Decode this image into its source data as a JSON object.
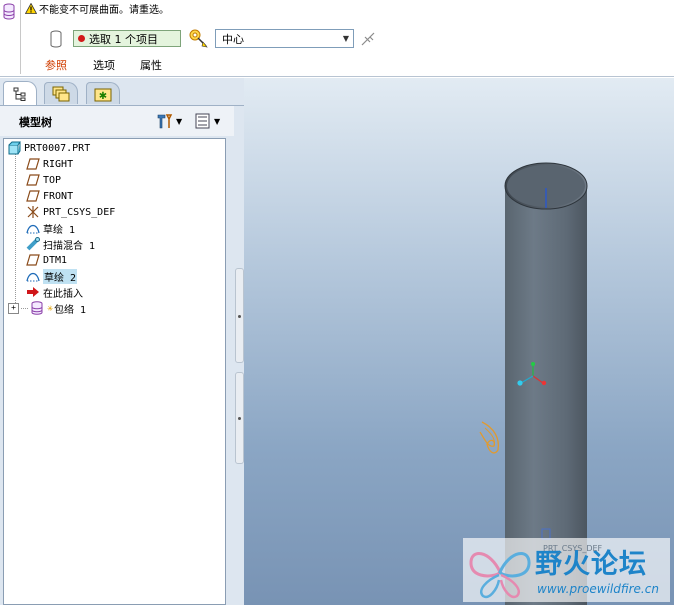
{
  "dashboard": {
    "message": "不能变不可展曲面。请重选。",
    "collector_label": "选取 1 个项目",
    "reference_combo": "中心",
    "tabs": [
      "参照",
      "选项",
      "属性"
    ]
  },
  "navigator": {
    "title": "模型树",
    "items": [
      {
        "label": "PRT0007.PRT",
        "icon": "part-icon"
      },
      {
        "label": "RIGHT",
        "icon": "datum-plane-icon"
      },
      {
        "label": "TOP",
        "icon": "datum-plane-icon"
      },
      {
        "label": "FRONT",
        "icon": "datum-plane-icon"
      },
      {
        "label": "PRT_CSYS_DEF",
        "icon": "csys-icon"
      },
      {
        "label": "草绘 1",
        "icon": "sketch-icon"
      },
      {
        "label": "扫描混合 1",
        "icon": "sweep-blend-icon"
      },
      {
        "label": "DTM1",
        "icon": "datum-plane-icon"
      },
      {
        "label": "草绘 2",
        "icon": "sketch-icon",
        "selected": true
      },
      {
        "label": "在此插入",
        "icon": "insert-arrow-icon"
      },
      {
        "label": "包络 1",
        "icon": "wrap-icon"
      }
    ]
  },
  "viewport": {
    "csys_label": "PRT_CSYS_DEF",
    "watermark_title": "野火论坛",
    "watermark_url": "www.proewildfire.cn"
  },
  "colors": {
    "selection": "#bfe1f2",
    "active_tab": "#d03e00",
    "viewport_top": "#e2ebf3",
    "viewport_bottom": "#7893b4",
    "cylinder": "#5f6c79"
  }
}
